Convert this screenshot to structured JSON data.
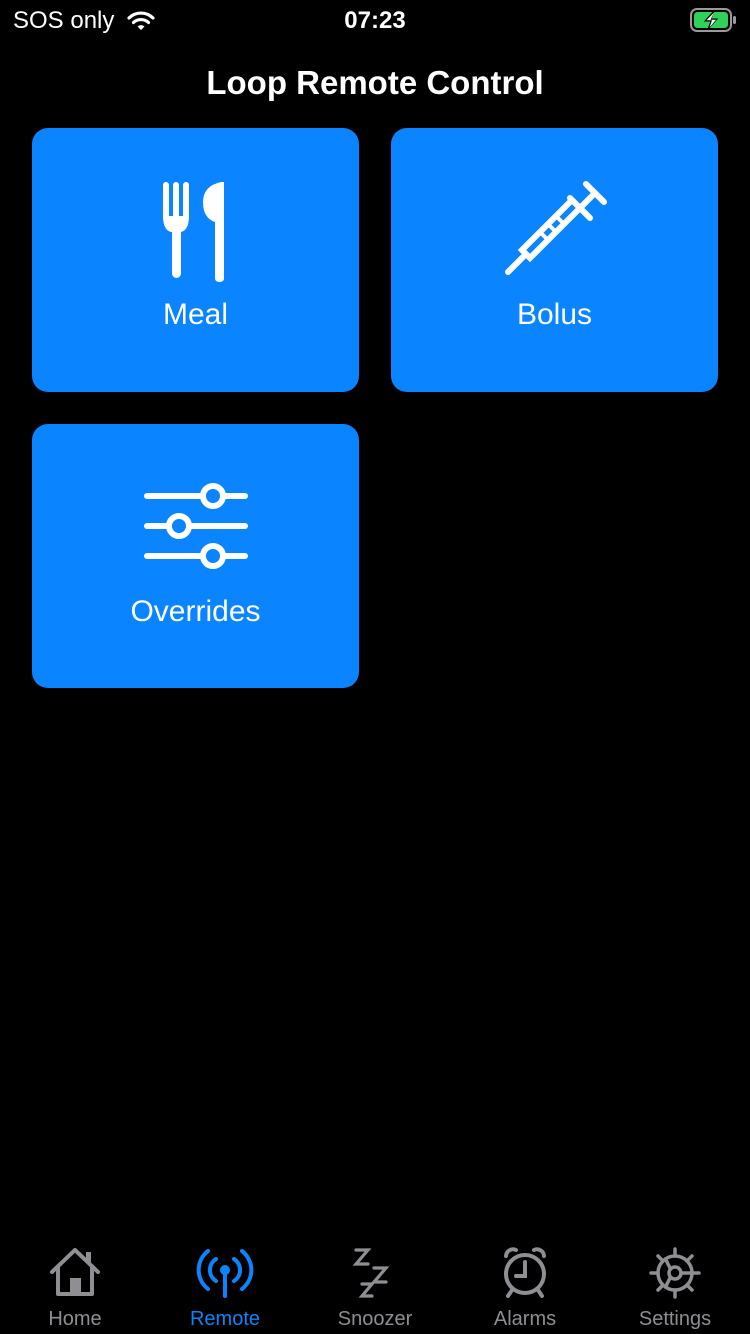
{
  "status_bar": {
    "carrier": "SOS only",
    "time": "07:23",
    "wifi_icon": "wifi-icon",
    "battery_icon": "battery-charging-icon",
    "battery_color": "#30d158"
  },
  "header": {
    "title": "Loop Remote Control"
  },
  "tiles": [
    {
      "label": "Meal",
      "icon": "fork-knife-icon"
    },
    {
      "label": "Bolus",
      "icon": "syringe-icon"
    },
    {
      "label": "Overrides",
      "icon": "sliders-icon"
    }
  ],
  "tab_bar": {
    "selected": "Remote",
    "items": [
      {
        "label": "Home",
        "icon": "house-icon"
      },
      {
        "label": "Remote",
        "icon": "antenna-icon"
      },
      {
        "label": "Snoozer",
        "icon": "zzz-icon"
      },
      {
        "label": "Alarms",
        "icon": "alarm-clock-icon"
      },
      {
        "label": "Settings",
        "icon": "gear-icon"
      }
    ]
  },
  "colors": {
    "accent": "#0a84ff",
    "background": "#000000",
    "inactive_tab": "#8e8e93"
  }
}
